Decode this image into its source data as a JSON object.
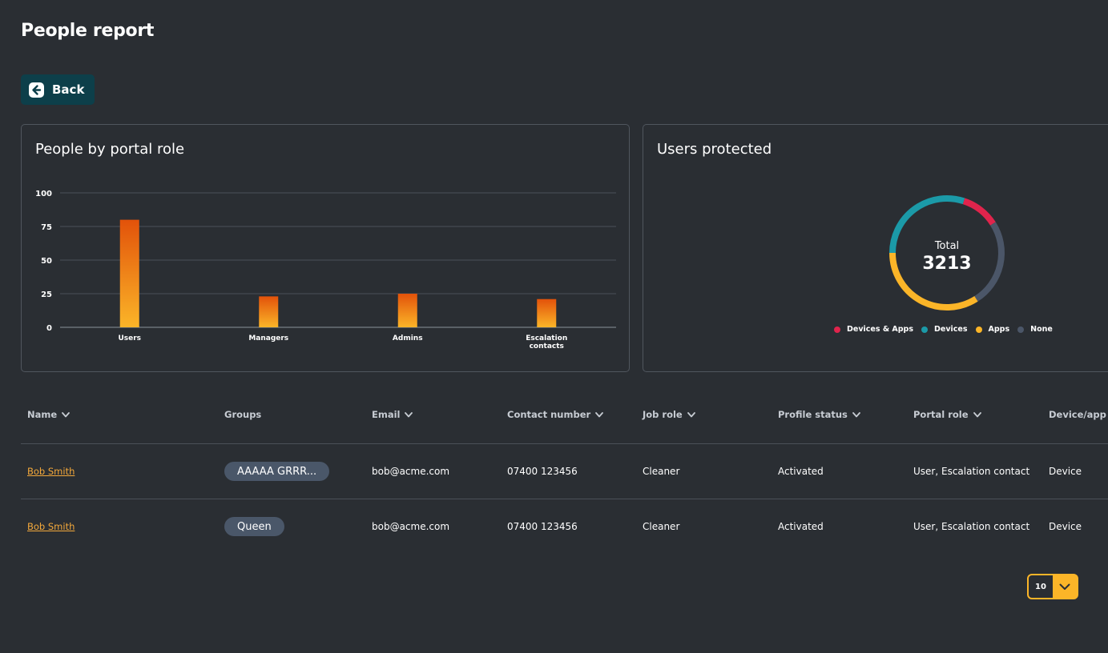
{
  "page": {
    "title": "People report"
  },
  "back_button": {
    "label": "Back"
  },
  "colors": {
    "background": "#2a2e33",
    "bar_top": "#e2520a",
    "bar_bottom": "#fbb528",
    "devices_and_apps": "#e0244c",
    "devices": "#1b9aa8",
    "apps": "#fbb528",
    "none": "#4b5668",
    "link": "#f4a93b"
  },
  "roles_card": {
    "title": "People by portal role"
  },
  "protected_card": {
    "title": "Users protected",
    "total_label": "Total",
    "total_value": "3213"
  },
  "chart_data": [
    {
      "type": "bar",
      "title": "People by portal role",
      "categories": [
        "Users",
        "Managers",
        "Admins",
        "Escalation contacts"
      ],
      "category_lines": [
        [
          "Users"
        ],
        [
          "Managers"
        ],
        [
          "Admins"
        ],
        [
          "Escalation",
          "contacts"
        ]
      ],
      "values": [
        80,
        23,
        25,
        21
      ],
      "ylim": [
        0,
        100
      ],
      "yticks": [
        0,
        25,
        50,
        75,
        100
      ],
      "grid": true
    },
    {
      "type": "pie",
      "title": "Users protected",
      "categories": [
        "Devices & Apps",
        "Devices",
        "Apps",
        "None"
      ],
      "values": [
        11,
        30,
        34,
        25
      ],
      "legend_position": "bottom"
    }
  ],
  "table": {
    "columns": [
      {
        "label": "Name",
        "sortable": true
      },
      {
        "label": "Groups",
        "sortable": false
      },
      {
        "label": "Email",
        "sortable": true
      },
      {
        "label": "Contact number",
        "sortable": true
      },
      {
        "label": "Job role",
        "sortable": true
      },
      {
        "label": "Profile status",
        "sortable": true
      },
      {
        "label": "Portal role",
        "sortable": true
      },
      {
        "label": "Device/app",
        "sortable": true
      }
    ],
    "rows": [
      {
        "name": "Bob Smith",
        "group": "AAAAA GRRR...",
        "email": "bob@acme.com",
        "contact": "07400 123456",
        "job_role": "Cleaner",
        "profile_status": "Activated",
        "portal_role": "User, Escalation contact",
        "device_app": "Device"
      },
      {
        "name": "Bob Smith",
        "group": "Queen",
        "email": "bob@acme.com",
        "contact": "07400 123456",
        "job_role": "Cleaner",
        "profile_status": "Activated",
        "portal_role": "User, Escalation contact",
        "device_app": "Device"
      }
    ]
  },
  "pagination": {
    "page_size": "10"
  }
}
